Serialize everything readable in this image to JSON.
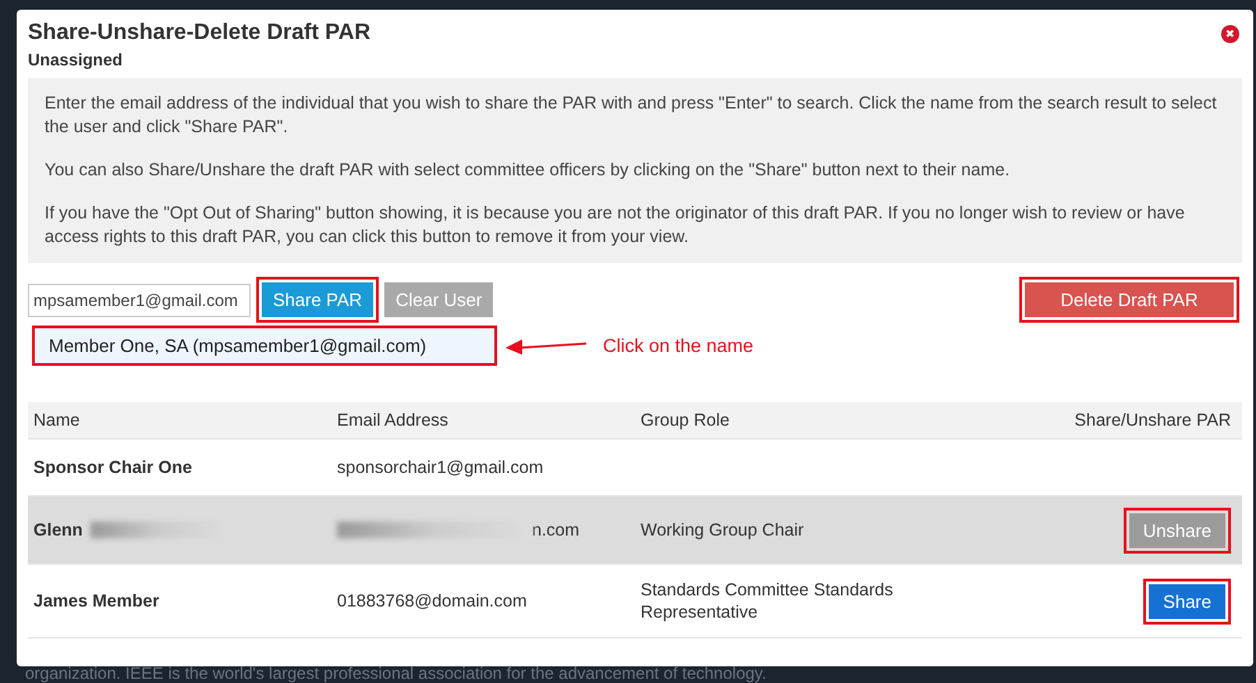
{
  "dialog": {
    "title": "Share-Unshare-Delete Draft PAR",
    "subtitle": "Unassigned",
    "close_icon": "✖"
  },
  "instructions": [
    "Enter the email address of the individual that you wish to share the PAR with and press \"Enter\" to search. Click the name from the search result to select the user and click \"Share PAR\".",
    "You can also Share/Unshare the draft PAR with select committee officers by clicking on the \"Share\" button next to their name.",
    "If you have the \"Opt Out of Sharing\" button showing, it is because you are not the originator of this draft PAR. If you no longer wish to review or have access rights to this draft PAR, you can click this button to remove it from your view."
  ],
  "search": {
    "value": "mpsamember1@gmail.com"
  },
  "buttons": {
    "share_par": {
      "label": "Share PAR",
      "annotated": true
    },
    "clear_user": {
      "label": "Clear User"
    },
    "delete": {
      "label": "Delete Draft PAR",
      "annotated": true
    }
  },
  "search_result": {
    "text": "Member One, SA (mpsamember1@gmail.com)",
    "annotated": true
  },
  "annotation": {
    "text": "Click on the name"
  },
  "table": {
    "columns": [
      "Name",
      "Email Address",
      "Group Role",
      "Share/Unshare PAR"
    ],
    "rows": [
      {
        "name": "Sponsor Chair One",
        "email": "sponsorchair1@gmail.com",
        "redacted": false,
        "highlighted": false
      },
      {
        "name": "Glenn",
        "email": "n.com",
        "role": "Working Group Chair",
        "redacted": true,
        "highlighted": true,
        "action": {
          "kind": "unshare",
          "label": "Unshare",
          "annotated": true
        }
      },
      {
        "name": "James Member",
        "email": "01883768@domain.com",
        "role": "Standards Committee Standards Representative",
        "redacted": false,
        "highlighted": false,
        "action": {
          "kind": "share",
          "label": "Share",
          "annotated": true
        }
      }
    ]
  },
  "background_text": "organization. IEEE is the world's largest professional association for the advancement of technology."
}
